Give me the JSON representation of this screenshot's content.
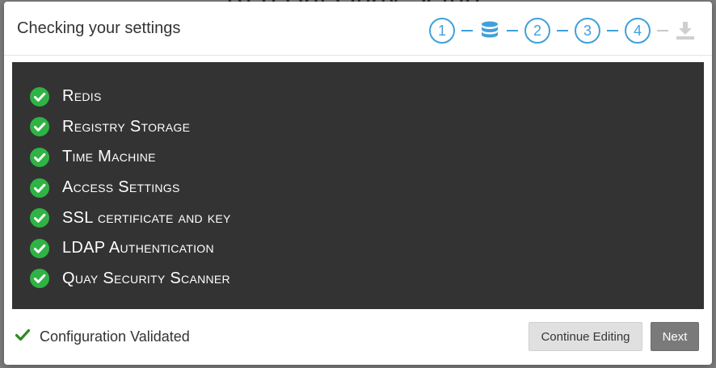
{
  "background": {
    "page_title": "Red Hat Quay Setup"
  },
  "modal": {
    "title": "Checking your settings",
    "steps": [
      "1",
      "2",
      "3",
      "4"
    ],
    "step_icons": {
      "database": "database-icon",
      "download": "download-icon"
    },
    "results": [
      {
        "label": "Redis",
        "status": "success"
      },
      {
        "label": "Registry Storage",
        "status": "success"
      },
      {
        "label": "Time Machine",
        "status": "success"
      },
      {
        "label": "Access Settings",
        "status": "success"
      },
      {
        "label": "SSL certificate and key",
        "status": "success"
      },
      {
        "label": "LDAP Authentication",
        "status": "success"
      },
      {
        "label": "Quay Security Scanner",
        "status": "success"
      }
    ],
    "footer": {
      "status_text": "Configuration Validated",
      "continue_label": "Continue Editing",
      "next_label": "Next"
    }
  },
  "colors": {
    "accent": "#3fa0db",
    "success": "#2fb344",
    "results_bg": "#333333"
  }
}
